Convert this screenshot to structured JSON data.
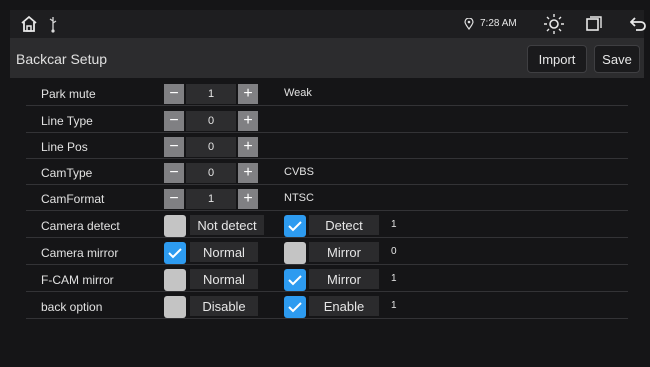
{
  "status": {
    "time": "7:28 AM",
    "icons": [
      "home-icon",
      "usb-icon",
      "location-icon",
      "brightness-icon",
      "windows-icon",
      "back-icon"
    ]
  },
  "header": {
    "title": "Backcar Setup",
    "import_label": "Import",
    "save_label": "Save"
  },
  "settings": {
    "park_mute": {
      "label": "Park mute",
      "value": "1",
      "text": "Weak"
    },
    "line_type": {
      "label": "Line Type",
      "value": "0"
    },
    "line_pos": {
      "label": "Line Pos",
      "value": "0"
    },
    "cam_type": {
      "label": "CamType",
      "value": "0",
      "text": "CVBS"
    },
    "cam_format": {
      "label": "CamFormat",
      "value": "1",
      "text": "NTSC"
    },
    "camera_detect": {
      "label": "Camera detect",
      "opt1": "Not detect",
      "opt2": "Detect",
      "opt1_checked": false,
      "opt2_checked": true,
      "count": "1"
    },
    "camera_mirror": {
      "label": "Camera mirror",
      "opt1": "Normal",
      "opt2": "Mirror",
      "opt1_checked": true,
      "opt2_checked": false,
      "count": "0"
    },
    "fcam_mirror": {
      "label": "F-CAM mirror",
      "opt1": "Normal",
      "opt2": "Mirror",
      "opt1_checked": false,
      "opt2_checked": true,
      "count": "1"
    },
    "back_option": {
      "label": "back option",
      "opt1": "Disable",
      "opt2": "Enable",
      "opt1_checked": false,
      "opt2_checked": true,
      "count": "1"
    }
  },
  "colors": {
    "accent": "#2d9bf0",
    "unchecked": "#c4c4c4",
    "stepper": "#808083"
  }
}
